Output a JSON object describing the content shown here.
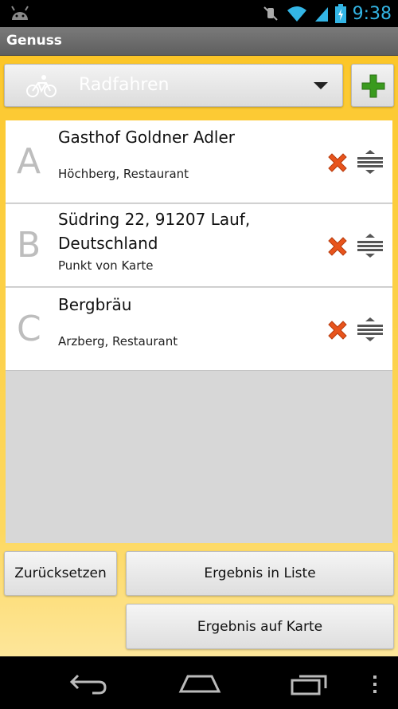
{
  "status_bar": {
    "time": "9:38",
    "icons": [
      "android-icon",
      "mute-icon",
      "wifi-icon",
      "signal-icon",
      "battery-charging-icon"
    ]
  },
  "app": {
    "title": "Genuss"
  },
  "mode_selector": {
    "selected": "Radfahren",
    "icon": "bicycle-icon"
  },
  "add_button": {
    "icon": "plus-icon",
    "color": "#3a9a1e"
  },
  "route_points": [
    {
      "letter": "A",
      "name": "Gasthof Goldner Adler",
      "detail": "Höchberg, Restaurant"
    },
    {
      "letter": "B",
      "name": "Südring 22, 91207 Lauf, Deutschland",
      "detail": "Punkt von Karte"
    },
    {
      "letter": "C",
      "name": "Bergbräu",
      "detail": "Arzberg, Restaurant"
    }
  ],
  "buttons": {
    "reset": "Zurücksetzen",
    "result_list": "Ergebnis in Liste",
    "result_map": "Ergebnis auf Karte"
  },
  "nav_bar": {
    "icons": [
      "back-icon",
      "home-icon",
      "recent-apps-icon",
      "overflow-menu-icon"
    ]
  },
  "colors": {
    "accent": "#fbbf19",
    "delete": "#e8541c",
    "status_time": "#33b5e5"
  }
}
